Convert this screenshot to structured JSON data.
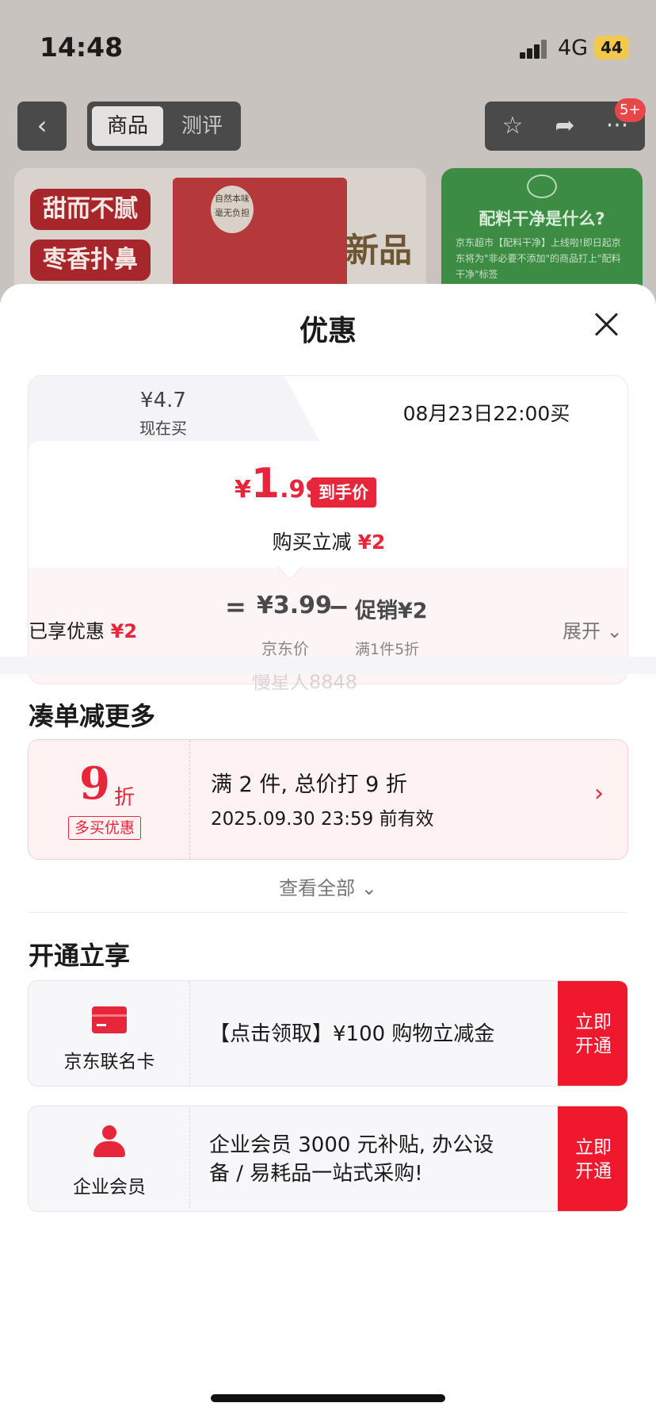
{
  "status_bar": {
    "time": "14:48",
    "network": "4G",
    "battery": "44"
  },
  "nav": {
    "tabs": [
      {
        "label": "商品"
      },
      {
        "label": "测评"
      }
    ],
    "badge": "5+"
  },
  "background": {
    "tag1": "甜而不腻",
    "tag2": "枣香扑鼻",
    "pack_label": "自然本味 毫无负担",
    "pack_text": "新品",
    "side_title": "配料干净是什么?",
    "side_text": "京东超市【配料干净】上线啦!即日起京东将为\"非必要不添加\"的商品打上\"配料干净\"标签"
  },
  "sheet": {
    "title": "优惠",
    "price_tabs": {
      "now_price": "¥4.7",
      "now_label": "现在买",
      "later_label": "08月23日22:00买"
    },
    "final_price": {
      "symbol": "¥",
      "integer": "1",
      "decimal": ".99",
      "tag": "到手价"
    },
    "instant": {
      "label": "购买立减",
      "amount": "¥2"
    },
    "formula": {
      "eq": "=",
      "jd_price": "¥3.99",
      "minus": "−",
      "promo": "促销¥2",
      "jd_label": "京东价",
      "promo_label": "满1件5折"
    },
    "watermark": "慢星人8848",
    "enjoyed": {
      "label": "已享优惠",
      "amount": "¥2"
    },
    "expand": "展开",
    "section1_title": "凑单减更多",
    "coupon": {
      "num": "9",
      "unit": "折",
      "tag": "多买优惠",
      "title": "满 2 件, 总价打 9 折",
      "valid": "2025.09.30 23:59 前有效"
    },
    "see_all": "查看全部",
    "section2_title": "开通立享",
    "offers": [
      {
        "name": "京东联名卡",
        "text": "【点击领取】¥100 购物立减金",
        "button": "立即开通",
        "icon": "credit-card-icon"
      },
      {
        "name": "企业会员",
        "text": " 企业会员 3000 元补贴, 办公设备 / 易耗品一站式采购!",
        "button": "立即开通",
        "icon": "person-icon"
      }
    ]
  },
  "colors": {
    "accent": "#e8263b",
    "button": "#f0182c"
  }
}
